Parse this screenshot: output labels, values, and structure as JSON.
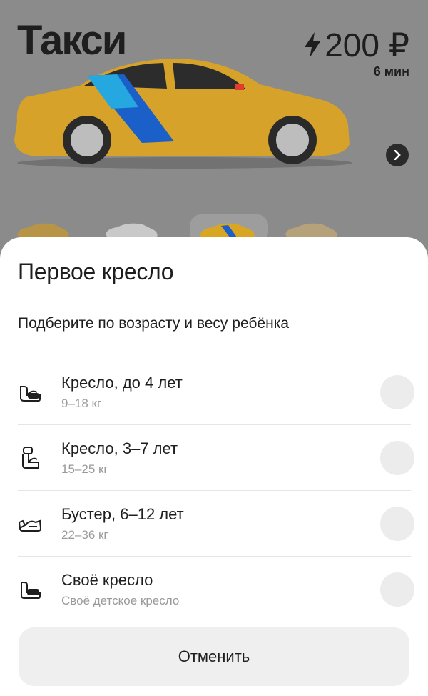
{
  "header": {
    "title": "Такси",
    "price": "200 ₽",
    "eta": "6 мин"
  },
  "sheet": {
    "title": "Первое кресло",
    "subtitle": "Подберите по возрасту и весу ребёнка",
    "options": [
      {
        "label": "Кресло, до 4 лет",
        "detail": "9–18 кг",
        "icon": "child-seat-icon",
        "selected": false
      },
      {
        "label": "Кресло, 3–7 лет",
        "detail": "15–25 кг",
        "icon": "child-seat-icon",
        "selected": false
      },
      {
        "label": "Бустер, 6–12 лет",
        "detail": "22–36 кг",
        "icon": "booster-seat-icon",
        "selected": false
      },
      {
        "label": "Своё кресло",
        "detail": "Своё детское кресло",
        "icon": "own-seat-icon",
        "selected": false
      }
    ],
    "cancel_label": "Отменить"
  },
  "colors": {
    "taxi_yellow": "#f3b61f",
    "accent_blue": "#1b5fc9",
    "accent_cyan": "#25a8e0",
    "sheet_bg": "#ffffff",
    "overlay_dim": "#8b8b8b"
  }
}
